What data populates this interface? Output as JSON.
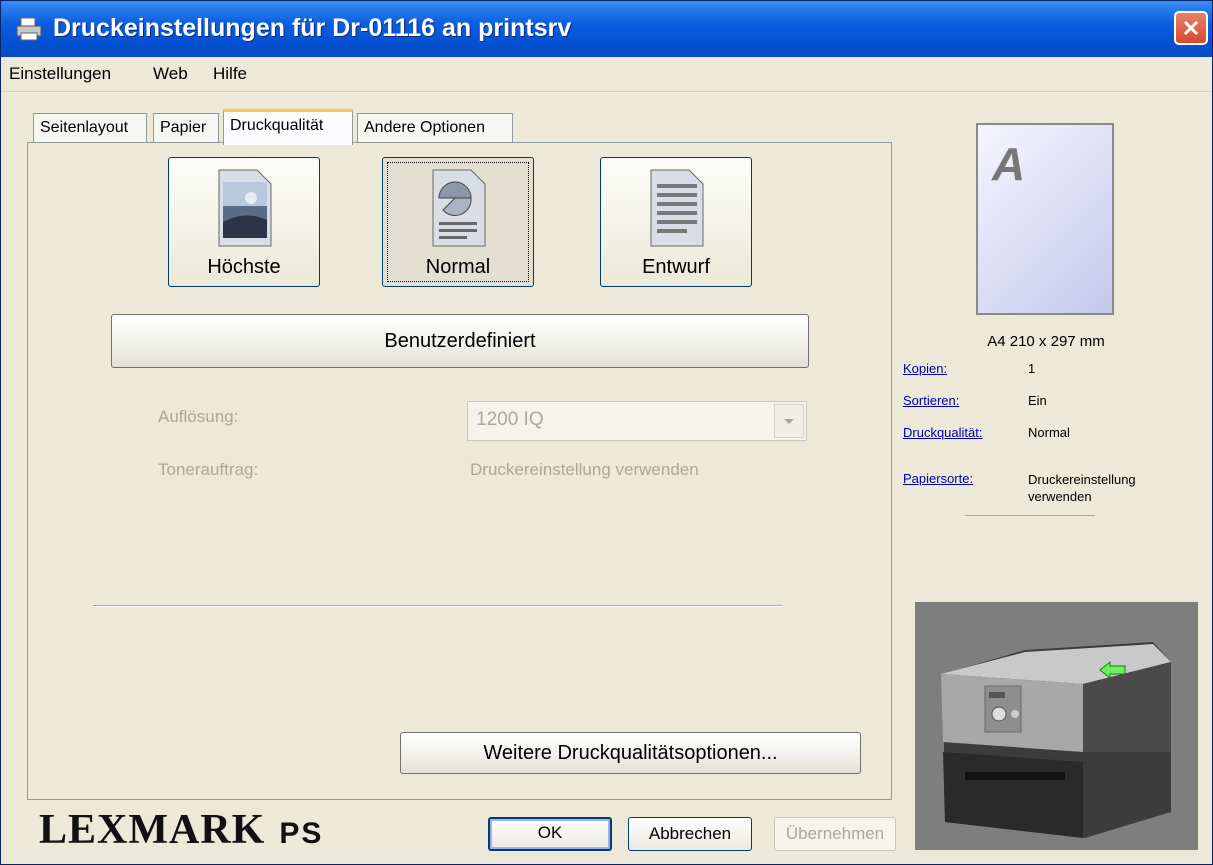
{
  "window": {
    "title": "Druckeinstellungen für Dr-01116 an printsrv",
    "icon": "printer-icon"
  },
  "menu": [
    {
      "label": "Einstellungen"
    },
    {
      "label": "Web"
    },
    {
      "label": "Hilfe"
    }
  ],
  "tabs": [
    "Seitenlayout",
    "Papier",
    "Druckqualität",
    "Andere Optionen"
  ],
  "active_tab": "Druckqualität",
  "quality": {
    "buttons": [
      {
        "label": "Höchste",
        "icon": "photo-document-icon"
      },
      {
        "label": "Normal",
        "icon": "chart-document-icon",
        "selected": true
      },
      {
        "label": "Entwurf",
        "icon": "text-document-icon"
      }
    ],
    "custom_label": "Benutzerdefiniert",
    "resolution_label": "Auflösung:",
    "resolution_value": "1200 IQ",
    "toner_label": "Tonerauftrag:",
    "toner_value": "Druckereinstellung verwenden",
    "more_options_label": "Weitere Druckqualitätsoptionen..."
  },
  "preview": {
    "letter": "A",
    "paper_size": "A4 210 x 297 mm"
  },
  "summary": [
    {
      "key": "Kopien:",
      "value": "1"
    },
    {
      "key": "Sortieren:",
      "value": "Ein"
    },
    {
      "key": "Druckqualität:",
      "value": "Normal"
    },
    {
      "key": "Papiersorte:",
      "value": "Druckereinstellung verwenden"
    }
  ],
  "brand": {
    "logo": "LEXMARK",
    "suffix": "PS"
  },
  "buttons": {
    "ok": "OK",
    "cancel": "Abbrechen",
    "apply": "Übernehmen"
  },
  "colors": {
    "titlebar": "#0a5ee0",
    "window_bg": "#ece9d8",
    "link": "#0000aa",
    "disabled": "#aca899",
    "tab_highlight": "#ffc83c"
  }
}
